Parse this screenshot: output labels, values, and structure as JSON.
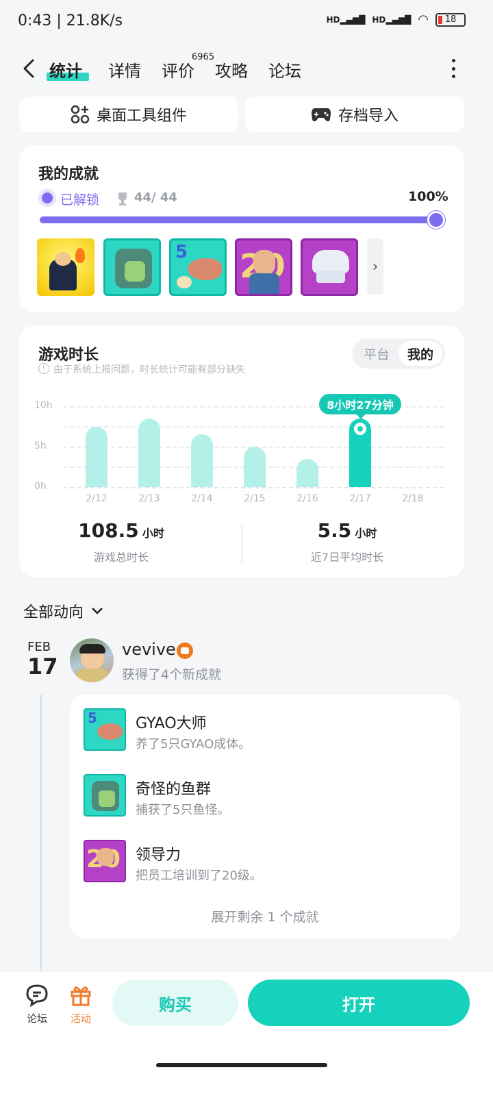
{
  "status": {
    "time": "0:43 | 21.8K/s",
    "battery": "18",
    "signal": "HD"
  },
  "nav": {
    "tabs": [
      {
        "label": "统计"
      },
      {
        "label": "详情"
      },
      {
        "label": "评价"
      },
      {
        "label": "攻略"
      },
      {
        "label": "论坛"
      }
    ],
    "review_count": "6965"
  },
  "top_buttons": {
    "widget": "桌面工具组件",
    "save_import": "存档导入"
  },
  "achievements": {
    "title": "我的成就",
    "unlocked_label": "已解锁",
    "count": "44/ 44",
    "percent": "100%",
    "progress": 1.0
  },
  "playtime": {
    "title": "游戏时长",
    "note": "由于系统上报问题，时长统计可能有部分缺失",
    "toggle": [
      "平台",
      "我的"
    ],
    "tooltip": "8小时27分钟",
    "total_value": "108.5",
    "total_unit": "小时",
    "total_label": "游戏总时长",
    "avg_value": "5.5",
    "avg_unit": "小时",
    "avg_label": "近7日平均时长"
  },
  "chart_data": {
    "type": "bar",
    "categories": [
      "2/12",
      "2/13",
      "2/14",
      "2/15",
      "2/16",
      "2/17",
      "2/18"
    ],
    "values": [
      7.5,
      8.5,
      6.5,
      5.0,
      3.5,
      8.45,
      0
    ],
    "y_ticks": [
      "10h",
      "5h",
      "0h"
    ],
    "ylim": [
      0,
      10
    ],
    "highlight_index": 5,
    "grid": true
  },
  "feed": {
    "filter_label": "全部动向",
    "date_month": "FEB",
    "date_day": "17",
    "user_name": "vevive",
    "activity": "获得了4个新成就",
    "items": [
      {
        "title": "GYAO大师",
        "desc": "养了5只GYAO成体。",
        "icon": "fish-5-badge"
      },
      {
        "title": "奇怪的鱼群",
        "desc": "捕获了5只鱼怪。",
        "icon": "monster-fish-badge"
      },
      {
        "title": "领导力",
        "desc": "把员工培训到了20级。",
        "icon": "level-20-badge"
      }
    ],
    "expand_label": "展开剩余 1 个成就"
  },
  "bottom": {
    "forum": "论坛",
    "activity": "活动",
    "buy": "购买",
    "open": "打开"
  },
  "colors": {
    "accent": "#16c8b3",
    "purple": "#7b6cf0",
    "bar": "#b3f0e7"
  }
}
